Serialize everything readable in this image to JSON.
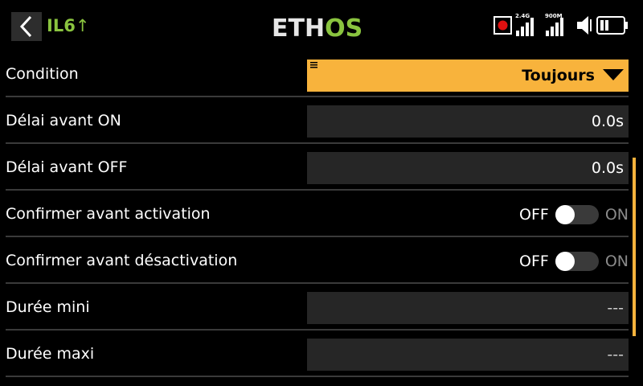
{
  "header": {
    "model_name": "IL6",
    "logo_eth": "ETH",
    "logo_os": "OS",
    "rf_label_1": "2.4G",
    "rf_label_2": "900M"
  },
  "rows": [
    {
      "label": "Condition",
      "type": "dropdown",
      "value": "Toujours"
    },
    {
      "label": "Délai avant ON",
      "type": "field",
      "value": "0.0s"
    },
    {
      "label": "Délai avant OFF",
      "type": "field",
      "value": "0.0s"
    },
    {
      "label": "Confirmer avant activation",
      "type": "toggle",
      "off": "OFF",
      "on": "ON"
    },
    {
      "label": "Confirmer avant désactivation",
      "type": "toggle",
      "off": "OFF",
      "on": "ON"
    },
    {
      "label": "Durée mini",
      "type": "field",
      "value": "---"
    },
    {
      "label": "Durée maxi",
      "type": "field",
      "value": "---"
    }
  ],
  "colors": {
    "accent": "#f8b33c",
    "model_green": "#8ac43f",
    "background": "#000000",
    "field_bg": "#262626"
  },
  "icons": {
    "back": "chevron-left-icon",
    "record": "record-icon",
    "signal": "signal-bars-icon",
    "speaker": "speaker-icon",
    "battery": "battery-icon",
    "menu": "menu-lines-icon",
    "dropdown_arrow": "triangle-down-icon"
  }
}
